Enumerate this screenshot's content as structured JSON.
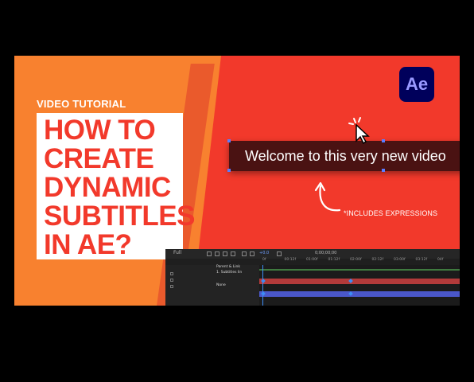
{
  "thumbnail": {
    "eyebrow": "VIDEO TUTORIAL",
    "title_lines": [
      "HOW TO",
      "CREATE",
      "DYNAMIC",
      "SUBTITLES",
      "IN AE?"
    ],
    "app_logo": "Ae",
    "subtitle_preview": "Welcome to this very new video",
    "note": "*INCLUDES EXPRESSIONS",
    "colors": {
      "background_red": "#f2392b",
      "panel_orange": "#f8812f",
      "title_red": "#f2392b",
      "subtitle_bar": "#4a1212",
      "logo_bg": "#00005b",
      "logo_text": "#9999ff"
    },
    "icons": {
      "cursor": "click-cursor-icon",
      "curve": "curved-arrow-icon"
    }
  },
  "timeline": {
    "zoom": "Full",
    "exposure": "+0.0",
    "timecode": "0;00;00;00",
    "ruler": [
      "0f",
      "00:12f",
      "01:00f",
      "01:12f",
      "02:00f",
      "02:12f",
      "03:00f",
      "03:12f",
      "04f"
    ],
    "column_header": "Parent & Link",
    "layers": [
      "1. Subtitles lin",
      "None"
    ],
    "colors": {
      "panel": "#1f1f1f",
      "track_green": "#3f7a3f",
      "track_red": "#b23a3a",
      "track_blue": "#4a57c9",
      "playhead": "#3d8df5"
    }
  }
}
